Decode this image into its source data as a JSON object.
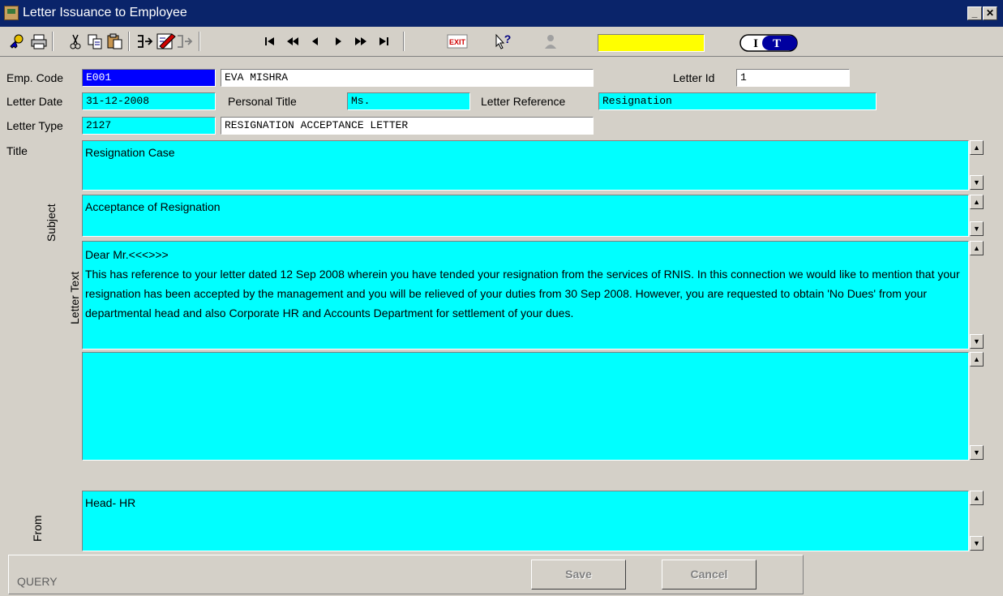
{
  "window": {
    "title": "Letter Issuance to Employee"
  },
  "toolbar": {
    "icons": [
      "key-icon",
      "print-icon",
      "cut-icon",
      "copy-icon",
      "paste-icon",
      "insert-record-icon",
      "edit-icon",
      "next-record-icon",
      "first-icon",
      "prev-page-icon",
      "prev-icon",
      "next-icon",
      "next-page-icon",
      "last-icon",
      "exit-icon",
      "help-icon",
      "user-icon"
    ],
    "exit_label": "EXIT",
    "logo_text": "IT"
  },
  "form": {
    "emp_code_label": "Emp. Code",
    "emp_code_value": "E001",
    "emp_name_value": "EVA  MISHRA",
    "letter_id_label": "Letter Id",
    "letter_id_value": "1",
    "letter_date_label": "Letter Date",
    "letter_date_value": "31-12-2008",
    "personal_title_label": "Personal Title",
    "personal_title_value": "Ms.",
    "letter_reference_label": "Letter Reference",
    "letter_reference_value": "Resignation",
    "letter_type_label": "Letter Type",
    "letter_type_value": "2127",
    "letter_type_desc": "RESIGNATION ACCEPTANCE LETTER",
    "title_label": "Title",
    "title_value": "Resignation Case",
    "subject_label": "Subject",
    "subject_value": "Acceptance of Resignation",
    "letter_text_label": "Letter Text",
    "letter_text_value": "Dear Mr.<<<>>>\nThis has reference to your letter dated 12 Sep 2008 wherein you have tended your resignation from the services of RNIS. In this connection we would like to mention that your resignation has been accepted by the management and you will be relieved of your duties from 30 Sep 2008. However, you are requested to obtain 'No Dues' from your departmental head and also Corporate HR and Accounts Department for settlement of your dues.",
    "letter_text_extra": "",
    "from_label": "From",
    "from_value": "Head- HR"
  },
  "status": {
    "mode": "QUERY"
  },
  "buttons": {
    "save": "Save",
    "cancel": "Cancel"
  },
  "colors": {
    "field_cyan": "#00ffff",
    "titlebar": "#0a246a",
    "window_bg": "#d4d0c8"
  }
}
